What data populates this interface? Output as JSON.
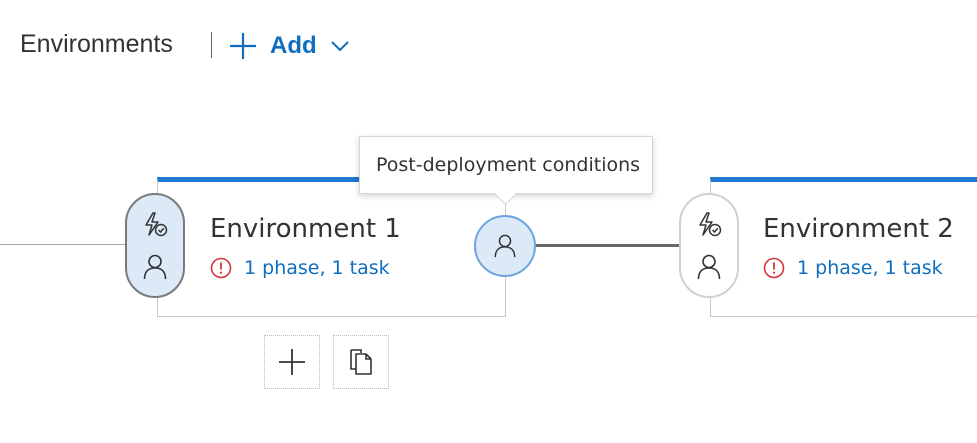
{
  "header": {
    "title": "Environments",
    "add_label": "Add"
  },
  "tooltip": {
    "text": "Post-deployment conditions"
  },
  "environments": [
    {
      "name": "Environment 1",
      "status": "1 phase, 1 task",
      "selected": true
    },
    {
      "name": "Environment 2",
      "status": "1 phase, 1 task",
      "selected": false
    }
  ],
  "icons": {
    "add": "plus-icon",
    "dropdown": "chevron-down-icon",
    "trigger": "lightning-check-icon",
    "approver": "person-icon",
    "error": "error-circle-icon",
    "clone": "clone-icon"
  },
  "colors": {
    "accent": "#106ebe",
    "card_top_bar": "#1e78d2",
    "error": "#d13438",
    "selected_fill": "#dce9f7"
  }
}
